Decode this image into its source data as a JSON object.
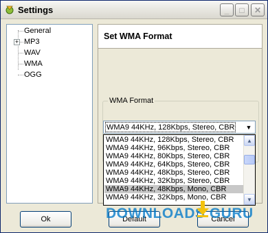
{
  "window": {
    "title": "Settings"
  },
  "tree": {
    "items": [
      {
        "label": "General",
        "expandable": false
      },
      {
        "label": "MP3",
        "expandable": true
      },
      {
        "label": "WAV",
        "expandable": false
      },
      {
        "label": "WMA",
        "expandable": false
      },
      {
        "label": "OGG",
        "expandable": false
      }
    ]
  },
  "panel": {
    "title": "Set WMA Format",
    "group_label": "WMA Format",
    "combo_value": "WMA9 44KHz, 128Kbps, Stereo, CBR",
    "options": [
      "WMA9 44KHz, 128Kbps, Stereo, CBR",
      "WMA9 44KHz, 96Kbps, Stereo, CBR",
      "WMA9 44KHz, 80Kbps, Stereo, CBR",
      "WMA9 44KHz, 64Kbps, Stereo, CBR",
      "WMA9 44KHz, 48Kbps, Stereo, CBR",
      "WMA9 44KHz, 32Kbps, Stereo, CBR",
      "WMA9 44KHz, 48Kbps, Mono, CBR",
      "WMA9 44KHz, 32Kbps, Mono, CBR"
    ],
    "selected_index": 6
  },
  "buttons": {
    "ok": "Ok",
    "default": "Default",
    "cancel": "Cancel"
  },
  "watermark": {
    "text": "DOWNLOADS GURU"
  },
  "colors": {
    "window_bg": "#ece9d8",
    "border_blue": "#7f9db9",
    "watermark": "#0078c8"
  }
}
